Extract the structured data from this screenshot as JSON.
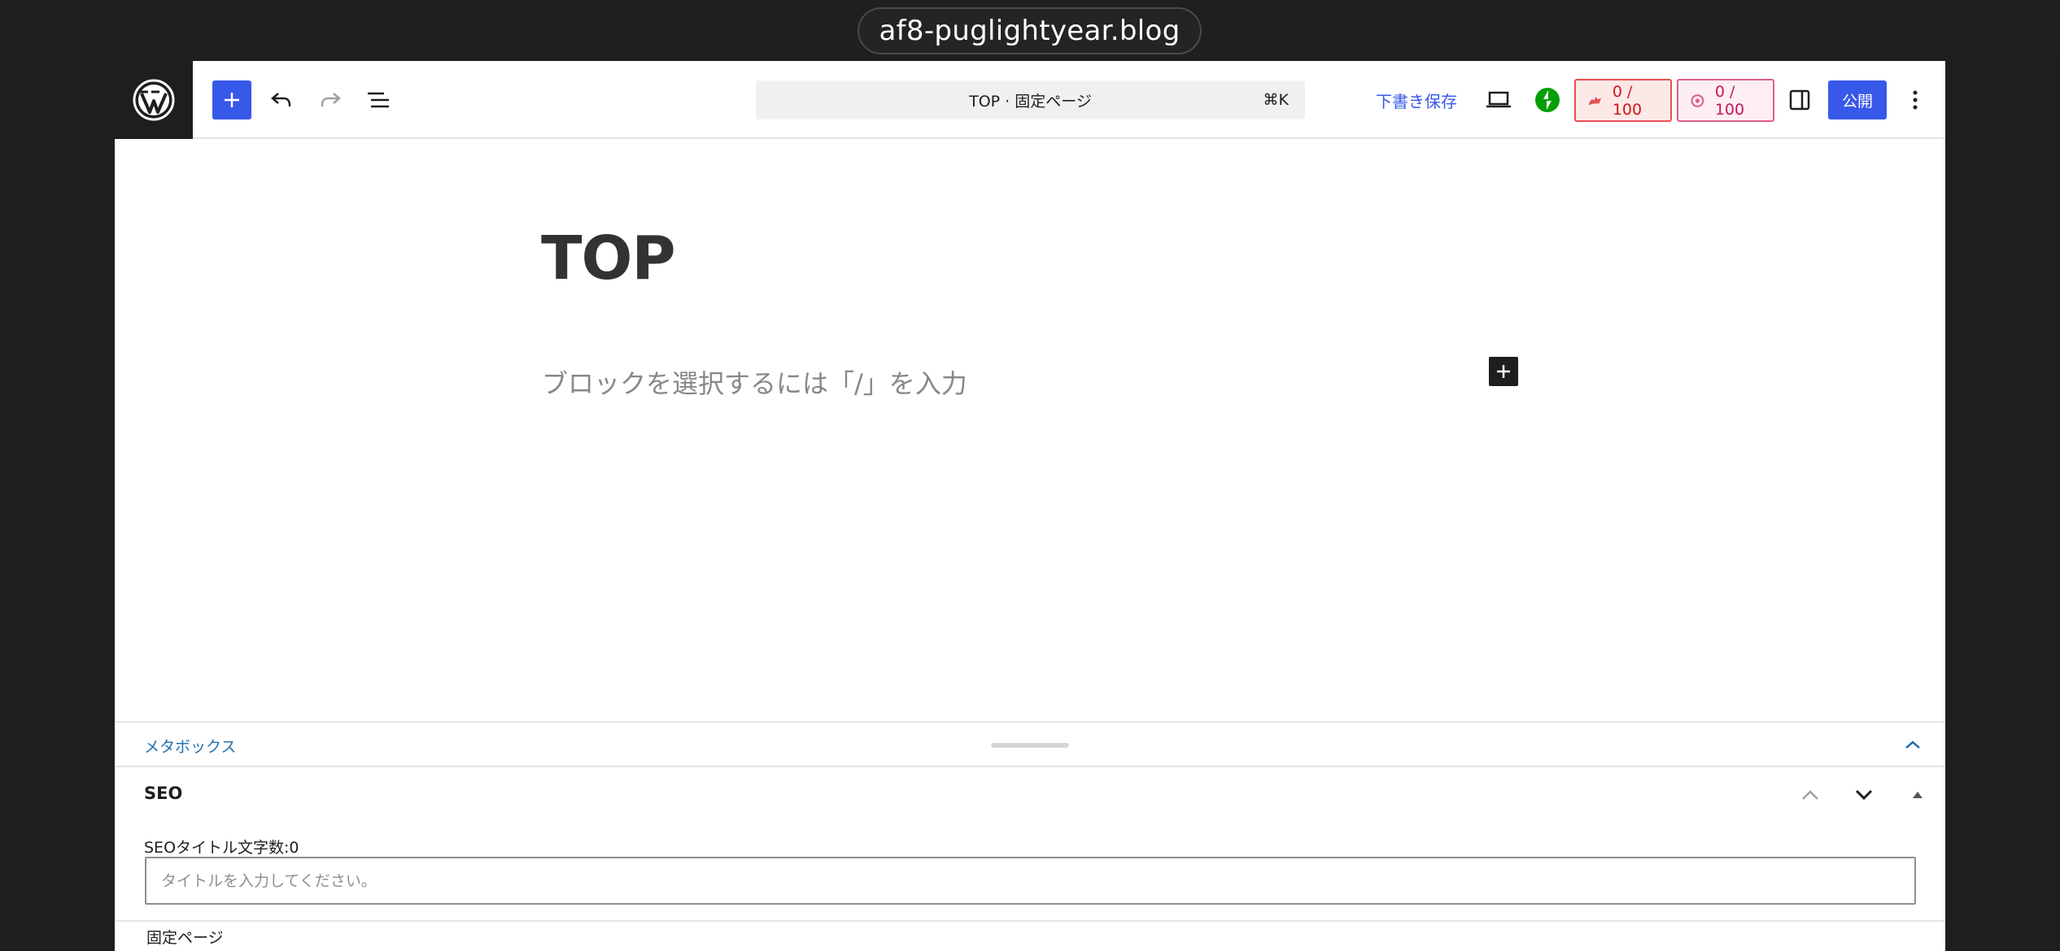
{
  "browser": {
    "url": "af8-puglightyear.blog"
  },
  "toolbar": {
    "command_title": "TOP · 固定ページ",
    "command_shortcut": "⌘K",
    "draft_label": "下書き保存",
    "seo_score": "0 / 100",
    "readability_score": "0 / 100",
    "publish_label": "公開",
    "icons": [
      "wordpress-logo-icon",
      "plus-icon",
      "undo-icon",
      "redo-icon",
      "list-view-icon",
      "desktop-preview-icon",
      "jetpack-icon",
      "seo-score-icon",
      "readability-score-icon",
      "sidebar-toggle-icon",
      "more-options-icon"
    ]
  },
  "editor": {
    "title": "TOP",
    "placeholder": "ブロックを選択するには「/」を入力"
  },
  "metabox": {
    "label": "メタボックス",
    "seo": {
      "heading": "SEO",
      "title_count_label": "SEOタイトル文字数:0",
      "title_placeholder": "タイトルを入力してください。"
    },
    "footer_label": "固定ページ"
  },
  "colors": {
    "accent": "#3858e9",
    "jetpack": "#069e08",
    "seo_badge": "#e65054",
    "readability_badge": "#e0608a",
    "metabox_link": "#2271b1"
  }
}
